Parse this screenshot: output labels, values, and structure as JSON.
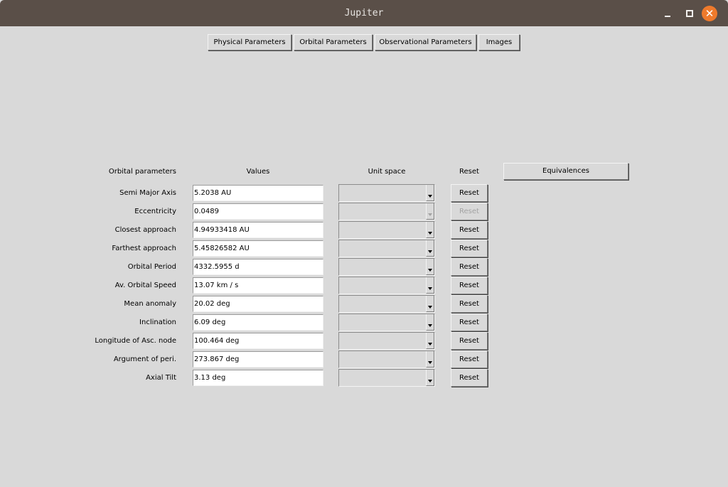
{
  "window": {
    "title": "Jupiter"
  },
  "tabs": [
    "Physical Parameters",
    "Orbital Parameters",
    "Observational Parameters",
    "Images"
  ],
  "headers": {
    "params": "Orbital parameters",
    "values": "Values",
    "unit_space": "Unit space",
    "reset": "Reset",
    "equivalences": "Equivalences"
  },
  "rows": [
    {
      "label": "Semi Major Axis",
      "value": "5.2038 AU",
      "reset": "Reset",
      "enabled": true
    },
    {
      "label": "Eccentricity",
      "value": "0.0489",
      "reset": "Reset",
      "enabled": false
    },
    {
      "label": "Closest approach",
      "value": "4.94933418 AU",
      "reset": "Reset",
      "enabled": true
    },
    {
      "label": "Farthest approach",
      "value": "5.45826582 AU",
      "reset": "Reset",
      "enabled": true
    },
    {
      "label": "Orbital Period",
      "value": "4332.5955 d",
      "reset": "Reset",
      "enabled": true
    },
    {
      "label": "Av. Orbital Speed",
      "value": "13.07 km / s",
      "reset": "Reset",
      "enabled": true
    },
    {
      "label": "Mean anomaly",
      "value": "20.02 deg",
      "reset": "Reset",
      "enabled": true
    },
    {
      "label": "Inclination",
      "value": "6.09 deg",
      "reset": "Reset",
      "enabled": true
    },
    {
      "label": "Longitude of Asc. node",
      "value": "100.464 deg",
      "reset": "Reset",
      "enabled": true
    },
    {
      "label": "Argument of peri.",
      "value": "273.867 deg",
      "reset": "Reset",
      "enabled": true
    },
    {
      "label": "Axial Tilt",
      "value": "3.13 deg",
      "reset": "Reset",
      "enabled": true
    }
  ],
  "colors": {
    "titlebar": "#5a4f48",
    "close_button": "#ee7a2c",
    "background": "#d9d9d9"
  },
  "icons": {
    "minimize": "minimize-icon",
    "maximize": "maximize-icon",
    "close": "close-icon"
  }
}
